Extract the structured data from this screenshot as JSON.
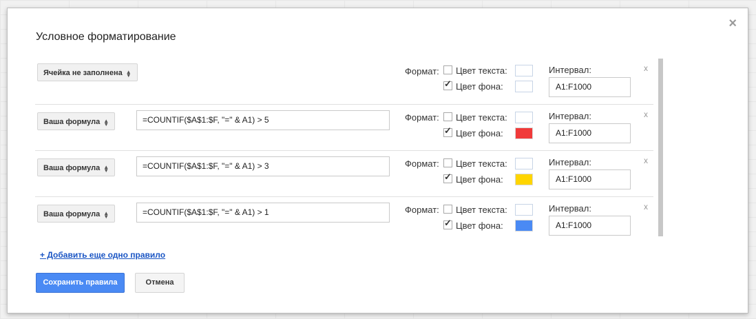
{
  "dialog": {
    "title": "Условное форматирование",
    "close_label": "×"
  },
  "labels": {
    "format": "Формат:",
    "text_color": "Цвет текста:",
    "bg_color": "Цвет фона:",
    "interval": "Интервал:",
    "delete": "x"
  },
  "rules": [
    {
      "condition": "Ячейка не заполнена",
      "formula": "",
      "text_color_checked": false,
      "bg_color_checked": true,
      "text_swatch": "#ffffff",
      "bg_swatch": "#ffffff",
      "range": "A1:F1000"
    },
    {
      "condition": "Ваша формула",
      "formula": "=COUNTIF($A$1:$F, \"=\" & A1) > 5",
      "text_color_checked": false,
      "bg_color_checked": true,
      "text_swatch": "#ffffff",
      "bg_swatch": "#f03a3a",
      "range": "A1:F1000"
    },
    {
      "condition": "Ваша формула",
      "formula": "=COUNTIF($A$1:$F, \"=\" & A1) > 3",
      "text_color_checked": false,
      "bg_color_checked": true,
      "text_swatch": "#ffffff",
      "bg_swatch": "#ffd500",
      "range": "A1:F1000"
    },
    {
      "condition": "Ваша формула",
      "formula": "=COUNTIF($A$1:$F, \"=\" & A1) > 1",
      "text_color_checked": false,
      "bg_color_checked": true,
      "text_swatch": "#ffffff",
      "bg_swatch": "#4a8af4",
      "range": "A1:F1000"
    }
  ],
  "icons": {
    "select_arrows": "⇕ (up-down-arrows-icon)",
    "checkmark": "✓"
  },
  "footer": {
    "add_rule": "+ Добавить еще одно правило",
    "save": "Сохранить правила",
    "cancel": "Отмена"
  }
}
